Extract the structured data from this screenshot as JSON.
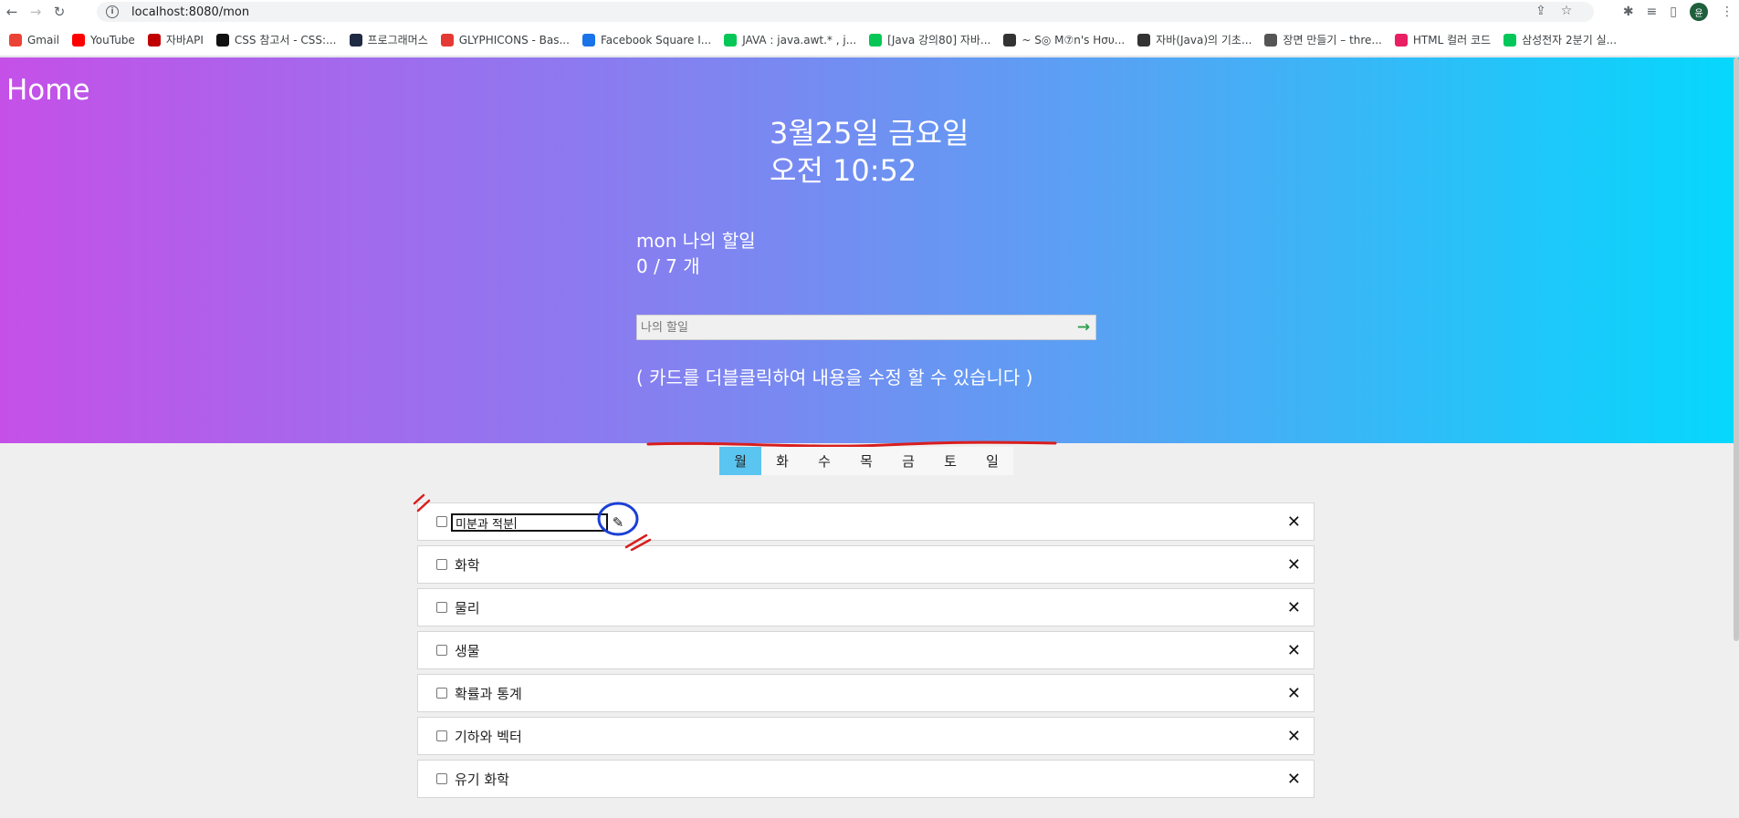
{
  "browser": {
    "url": "localhost:8080/mon",
    "profile_initial": "윤"
  },
  "bookmarks": [
    {
      "label": "Gmail",
      "color": "#ea4335"
    },
    {
      "label": "YouTube",
      "color": "#ff0000"
    },
    {
      "label": "자바API",
      "color": "#c00000"
    },
    {
      "label": "CSS 참고서 - CSS:...",
      "color": "#111111"
    },
    {
      "label": "프로그래머스",
      "color": "#1f2a44"
    },
    {
      "label": "GLYPHICONS - Bas...",
      "color": "#e53935"
    },
    {
      "label": "Facebook Square I...",
      "color": "#1a73e8"
    },
    {
      "label": "JAVA : java.awt.* , j...",
      "color": "#06c755"
    },
    {
      "label": "[Java 강의80] 자바...",
      "color": "#06c755"
    },
    {
      "label": "~ S◎ M⑦n's Hσυ...",
      "color": "#333333"
    },
    {
      "label": "자바(Java)의 기초...",
      "color": "#333333"
    },
    {
      "label": "장면 만들기 – thre...",
      "color": "#555555"
    },
    {
      "label": "HTML 컬러 코드",
      "color": "#e91e63"
    },
    {
      "label": "삼성전자 2분기 실...",
      "color": "#03c75a"
    }
  ],
  "page": {
    "home": "Home",
    "date": "3월25일 금요일",
    "time": "오전 10:52",
    "todo_title": "mon 나의 할일",
    "todo_count": "0 / 7 개",
    "input_placeholder": "나의 할일",
    "hint": "( 카드를 더블클릭하여 내용을 수정 할 수 있습니다 )"
  },
  "days": {
    "items": [
      "월",
      "화",
      "수",
      "목",
      "금",
      "토",
      "일"
    ],
    "active": "월"
  },
  "tasks": {
    "editing_value": "미분과 적분",
    "items": [
      "화학",
      "물리",
      "생물",
      "확률과 통계",
      "기하와 벡터",
      "유기 화학"
    ],
    "delete_symbol": "✕"
  }
}
